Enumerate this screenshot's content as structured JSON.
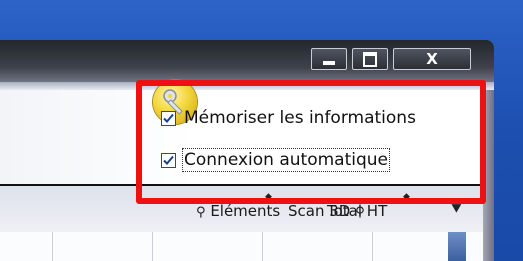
{
  "window": {
    "controls": {
      "minimize": "minimize",
      "maximize": "maximize",
      "close": "X"
    }
  },
  "options": [
    {
      "label": "Mémoriser les informations",
      "checked": true
    },
    {
      "label": "Connexion automatique",
      "checked": true
    }
  ],
  "columns": [
    "Eléments",
    "Total HT",
    "Scan 3D"
  ],
  "icons": {
    "key": "key-icon",
    "search": "search-icon",
    "chevron": "chevron-double-down-icon"
  },
  "colors": {
    "highlight": "#ee1111",
    "accent": "#1f56b8"
  }
}
